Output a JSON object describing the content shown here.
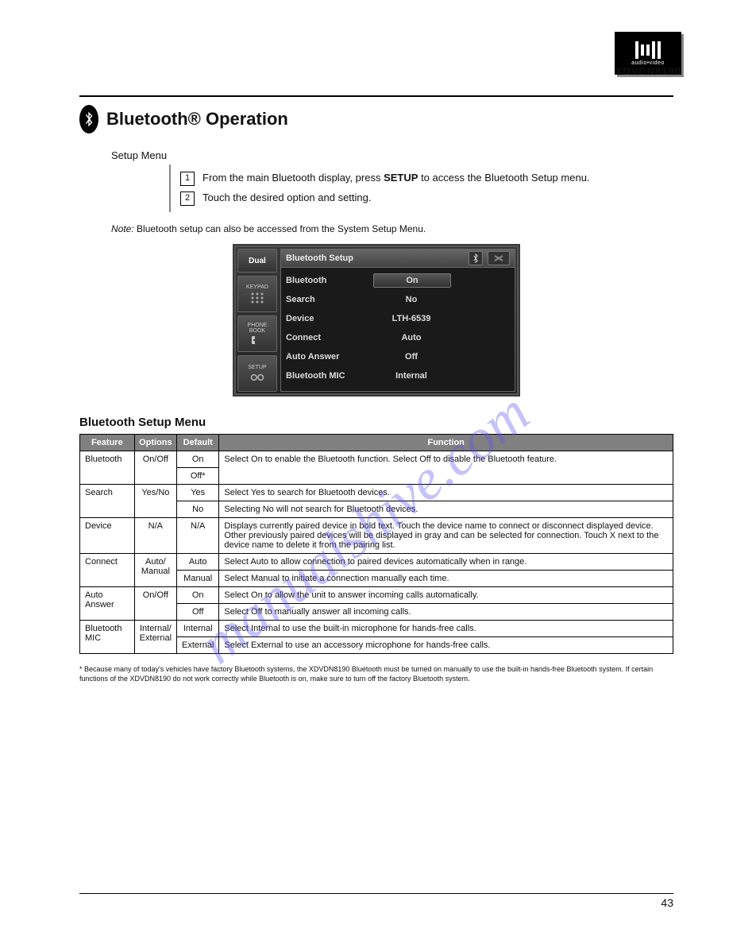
{
  "header": {
    "logo_sub": "audio•video",
    "product": "XDVDN8190"
  },
  "section": {
    "title": "Bluetooth® Operation",
    "intro": "Setup Menu",
    "steps": [
      {
        "num": "1",
        "text_a": "From the main Bluetooth display, press ",
        "keyword": "SETUP",
        "text_b": " to access the Bluetooth Setup menu."
      },
      {
        "num": "2",
        "text": "Touch the desired option and setting."
      }
    ],
    "note_label": "Note:",
    "note_text": " Bluetooth setup can also be accessed from the System Setup Menu."
  },
  "device": {
    "sidebar": {
      "logo": "Dual",
      "keypad": "KEYPAD",
      "phonebook_a": "PHONE",
      "phonebook_b": "BOOK",
      "setup": "SETUP"
    },
    "screen": {
      "title": "Bluetooth Setup",
      "rows": [
        {
          "label": "Bluetooth",
          "value": "On"
        },
        {
          "label": "Search",
          "value": "No"
        },
        {
          "label": "Device",
          "value": "LTH-6539"
        },
        {
          "label": "Connect",
          "value": "Auto"
        },
        {
          "label": "Auto Answer",
          "value": "Off"
        },
        {
          "label": "Bluetooth MIC",
          "value": "Internal"
        }
      ]
    }
  },
  "table": {
    "title": "Bluetooth Setup Menu",
    "headers": [
      "Feature",
      "Options",
      "Default",
      "Function"
    ],
    "rows": [
      {
        "feature": "Bluetooth",
        "options": "On/Off",
        "defaults": [
          "On",
          "Off*"
        ],
        "function": "Select On to enable the Bluetooth function. Select Off to disable the Bluetooth feature."
      },
      {
        "feature": "Search",
        "options": "Yes/No",
        "defaults": [
          "Yes",
          "No"
        ],
        "function": "Select Yes to search for Bluetooth devices.",
        "function2": "Selecting No will not search for Bluetooth devices."
      },
      {
        "feature": "Device",
        "options": "N/A",
        "defaults": [
          "N/A"
        ],
        "function": "Displays currently paired device in bold text. Touch the device name to connect or disconnect displayed device. Other previously paired devices will be displayed in gray and can be selected for connection. Touch X next to the device name to delete it from the pairing list."
      },
      {
        "feature": "Connect",
        "options_a": "Auto/",
        "options_b": "Manual",
        "defaults": [
          "Auto",
          "Manual"
        ],
        "function": "Select Auto to allow connection to paired devices automatically when in range.",
        "function2": "Select Manual to initiate a connection manually each time."
      },
      {
        "feature": "Auto Answer",
        "options": "On/Off",
        "defaults": [
          "On",
          "Off"
        ],
        "function": "Select On to allow the unit to answer incoming calls automatically.",
        "function2": "Select Off to manually answer all incoming calls."
      },
      {
        "feature": "Bluetooth MIC",
        "options_a": "Internal/",
        "options_b": "External",
        "defaults": [
          "Internal",
          "External"
        ],
        "function": "Select Internal to use the built-in microphone for hands-free calls.",
        "function2": "Select External to use an accessory microphone for hands-free calls."
      }
    ]
  },
  "footnote": "* Because many of today's vehicles have factory Bluetooth systems, the XDVDN8190 Bluetooth must be turned on manually to use the built-in hands-free Bluetooth system.  If certain functions of the XDVDN8190 do not work correctly while Bluetooth is on, make sure to turn off the factory Bluetooth system.",
  "watermark": "manualshive.com",
  "footer": {
    "page": "43"
  }
}
